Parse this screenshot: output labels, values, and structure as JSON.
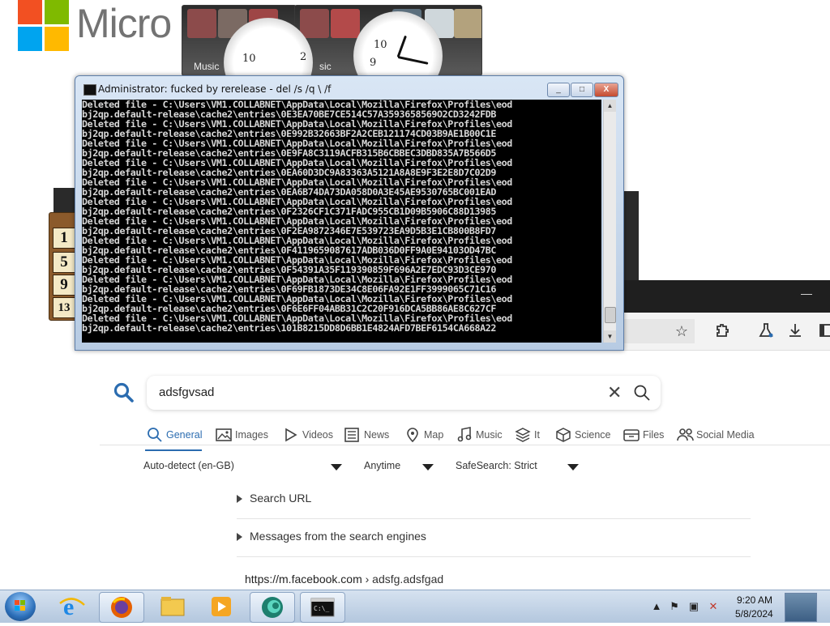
{
  "desktop": {
    "logo_text": "Micro",
    "music_gadget_label_1": "Music",
    "music_gadget_label_2": "sic",
    "clock_numbers": [
      "10",
      "2",
      "9"
    ],
    "calc_cells": [
      "1",
      "5",
      "9",
      "13"
    ]
  },
  "console": {
    "title": "Administrator: fucked by rerelease - del /s /q \\ /f",
    "min_label": "_",
    "max_label": "□",
    "close_label": "X",
    "lines": [
      "Deleted file - C:\\Users\\VM1.COLLABNET\\AppData\\Local\\Mozilla\\Firefox\\Profiles\\eod",
      "bj2qp.default-release\\cache2\\entries\\0E3EA70BE7CE514C57A3593658569O2CD3242FDB",
      "Deleted file - C:\\Users\\VM1.COLLABNET\\AppData\\Local\\Mozilla\\Firefox\\Profiles\\eod",
      "bj2qp.default-release\\cache2\\entries\\0E992B32663BF2A2CEB121174CD03B9AE1B00C1E",
      "Deleted file - C:\\Users\\VM1.COLLABNET\\AppData\\Local\\Mozilla\\Firefox\\Profiles\\eod",
      "bj2qp.default-release\\cache2\\entries\\0E9FA8C3119ACFB315B6CBBEC3DBD835A7B566D5",
      "Deleted file - C:\\Users\\VM1.COLLABNET\\AppData\\Local\\Mozilla\\Firefox\\Profiles\\eod",
      "bj2qp.default-release\\cache2\\entries\\0EA60D3DC9A83363A5121A8A8E9F3E2E8D7C02D9",
      "Deleted file - C:\\Users\\VM1.COLLABNET\\AppData\\Local\\Mozilla\\Firefox\\Profiles\\eod",
      "bj2qp.default-release\\cache2\\entries\\0EA6B74DA73DA058D0A3E45AE9530765BC001EAD",
      "Deleted file - C:\\Users\\VM1.COLLABNET\\AppData\\Local\\Mozilla\\Firefox\\Profiles\\eod",
      "bj2qp.default-release\\cache2\\entries\\0F2326CF1C371FADC955CB1D09B5906C88D13985",
      "Deleted file - C:\\Users\\VM1.COLLABNET\\AppData\\Local\\Mozilla\\Firefox\\Profiles\\eod",
      "bj2qp.default-release\\cache2\\entries\\0F2EA9872346E7E539723EA9D5B3E1CB800B8FD7",
      "Deleted file - C:\\Users\\VM1.COLLABNET\\AppData\\Local\\Mozilla\\Firefox\\Profiles\\eod",
      "bj2qp.default-release\\cache2\\entries\\0F4119659087617ADB036D0FF9A0E94103OD47BC",
      "Deleted file - C:\\Users\\VM1.COLLABNET\\AppData\\Local\\Mozilla\\Firefox\\Profiles\\eod",
      "bj2qp.default-release\\cache2\\entries\\0F54391A35F119390859F696A2E7EDC93D3CE970",
      "Deleted file - C:\\Users\\VM1.COLLABNET\\AppData\\Local\\Mozilla\\Firefox\\Profiles\\eod",
      "bj2qp.default-release\\cache2\\entries\\0F69FB1873DE34C8E06FA92E1FF3999065C71C16",
      "Deleted file - C:\\Users\\VM1.COLLABNET\\AppData\\Local\\Mozilla\\Firefox\\Profiles\\eod",
      "bj2qp.default-release\\cache2\\entries\\0F6E6FF04ABB31C2C20F916DCA5BB86AE8C627CF",
      "Deleted file - C:\\Users\\VM1.COLLABNET\\AppData\\Local\\Mozilla\\Firefox\\Profiles\\eod",
      "bj2qp.default-release\\cache2\\entries\\101B8215DD8D6BB1E4824AFD7BEF6154CA668A22"
    ]
  },
  "search": {
    "query": "adsfgvsad",
    "tabs": [
      {
        "label": "General",
        "icon": "search-icon"
      },
      {
        "label": "Images",
        "icon": "image-icon"
      },
      {
        "label": "Videos",
        "icon": "play-icon"
      },
      {
        "label": "News",
        "icon": "newspaper-icon"
      },
      {
        "label": "Map",
        "icon": "map-pin-icon"
      },
      {
        "label": "Music",
        "icon": "music-note-icon"
      },
      {
        "label": "It",
        "icon": "layers-icon"
      },
      {
        "label": "Science",
        "icon": "cube-icon"
      },
      {
        "label": "Files",
        "icon": "file-box-icon"
      },
      {
        "label": "Social Media",
        "icon": "people-icon"
      }
    ],
    "filters": {
      "language": "Auto-detect (en-GB)",
      "time": "Anytime",
      "safesearch": "SafeSearch: Strict"
    },
    "accordions": [
      "Search URL",
      "Messages from the search engines"
    ],
    "result": {
      "host": "https://m.facebook.com",
      "path": "› adsfg.adsfgad"
    }
  },
  "taskbar": {
    "time": "9:20 AM",
    "date": "5/8/2024",
    "items": [
      "internet-explorer",
      "firefox",
      "file-explorer",
      "media-player",
      "browser-app",
      "command-prompt"
    ]
  },
  "colors": {
    "accent": "#2b6cb0",
    "console_bg": "#000000",
    "taskbar": "#c4d4e8"
  }
}
